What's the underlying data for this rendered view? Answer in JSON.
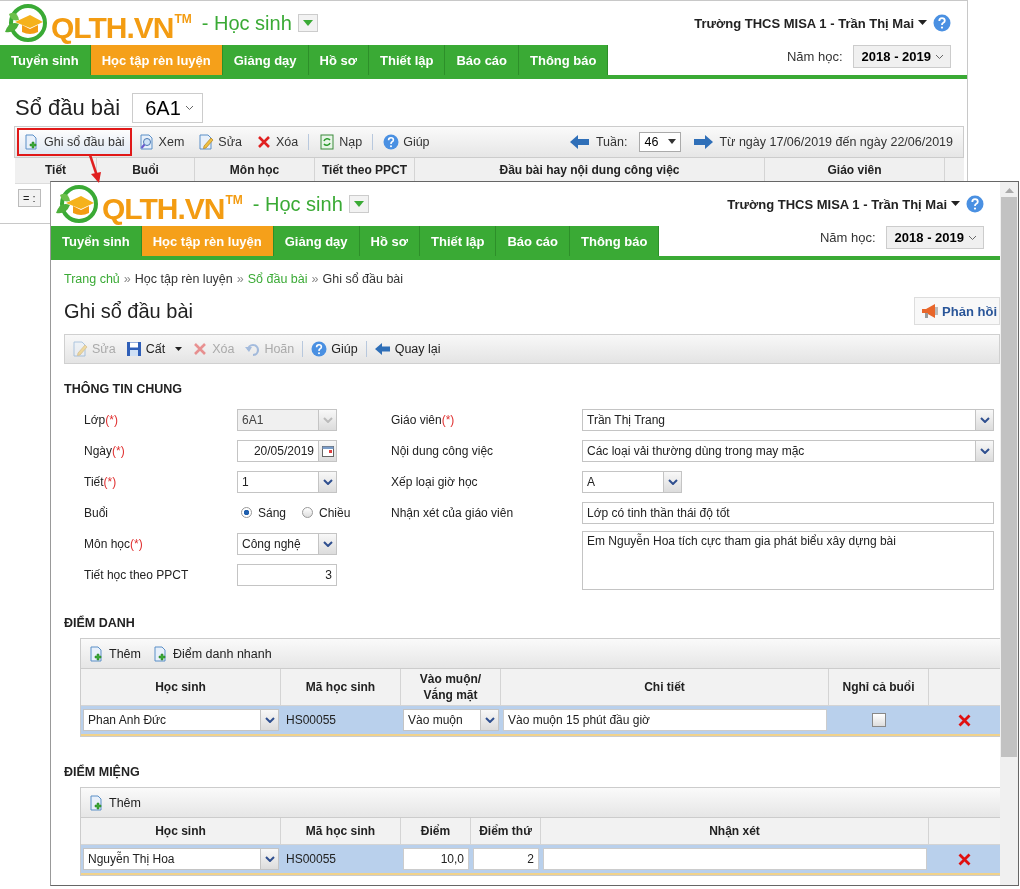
{
  "back_window": {
    "header": {
      "brand": "QLTH.VN",
      "trademark": "TM",
      "role": "- Học sinh",
      "user": "Trường THCS MISA 1 - Trần Thị Mai"
    },
    "nav": [
      {
        "label": "Tuyển sinh",
        "selected": false
      },
      {
        "label": "Học tập rèn luyện",
        "selected": true
      },
      {
        "label": "Giảng dạy",
        "selected": false
      },
      {
        "label": "Hồ sơ",
        "selected": false
      },
      {
        "label": "Thiết lập",
        "selected": false
      },
      {
        "label": "Báo cáo",
        "selected": false
      },
      {
        "label": "Thông báo",
        "selected": false
      }
    ],
    "school_year": {
      "label": "Năm học:",
      "value": "2018 - 2019"
    },
    "page_title": "Sổ đầu bài",
    "class_select": "6A1",
    "toolbar_groups": [
      {
        "items": [
          {
            "label": "Ghi sổ đầu bài",
            "kind": "add",
            "highlighted": true
          },
          {
            "label": "Xem",
            "kind": "view",
            "highlighted": false
          },
          {
            "label": "Sửa",
            "kind": "edit",
            "highlighted": false
          },
          {
            "label": "Xóa",
            "kind": "delete",
            "highlighted": false
          }
        ]
      },
      {
        "items": [
          {
            "label": "Nạp",
            "kind": "reload",
            "highlighted": false
          }
        ]
      },
      {
        "items": [
          {
            "label": "Giúp",
            "kind": "help",
            "highlighted": false
          }
        ]
      }
    ],
    "week": {
      "label": "Tuần:",
      "value": "46",
      "range": "Từ ngày 17/06/2019 đến ngày 22/06/2019"
    },
    "columns": [
      "Tiết",
      "Buổi",
      "Môn học",
      "Tiết theo PPCT",
      "Đầu bài hay nội dung công việc",
      "Giáo viên"
    ],
    "filter_operator": "= :"
  },
  "front_window": {
    "header": {
      "brand": "QLTH.VN",
      "trademark": "TM",
      "role": "- Học sinh",
      "user": "Trường THCS MISA 1 - Trần Thị Mai"
    },
    "nav": [
      {
        "label": "Tuyển sinh",
        "selected": false
      },
      {
        "label": "Học tập rèn luyện",
        "selected": true
      },
      {
        "label": "Giảng dạy",
        "selected": false
      },
      {
        "label": "Hồ sơ",
        "selected": false
      },
      {
        "label": "Thiết lập",
        "selected": false
      },
      {
        "label": "Báo cáo",
        "selected": false
      },
      {
        "label": "Thông báo",
        "selected": false
      }
    ],
    "school_year": {
      "label": "Năm học:",
      "value": "2018 - 2019"
    },
    "breadcrumbs": [
      {
        "label": "Trang chủ",
        "link": true
      },
      {
        "prefix": "»",
        "label": "Học tập rèn luyện",
        "link": false
      },
      {
        "prefix": "»",
        "label": "Sổ đầu bài",
        "link": true
      },
      {
        "prefix": "»",
        "label": "Ghi sổ đầu bài",
        "link": false
      }
    ],
    "page_title": "Ghi sổ đầu bài",
    "feedback_button": "Phản hồi",
    "toolbar_groups": [
      {
        "items": [
          {
            "label": "Sửa",
            "kind": "edit",
            "disabled": true,
            "menu": false
          },
          {
            "label": "Cất",
            "kind": "save",
            "disabled": false,
            "menu": true
          },
          {
            "label": "Xóa",
            "kind": "delete",
            "disabled": true,
            "menu": false
          },
          {
            "label": "Hoãn",
            "kind": "undo",
            "disabled": true,
            "menu": false
          }
        ]
      },
      {
        "items": [
          {
            "label": "Giúp",
            "kind": "help",
            "disabled": false,
            "menu": false
          }
        ]
      },
      {
        "items": [
          {
            "label": "Quay lại",
            "kind": "back",
            "disabled": false,
            "menu": false
          }
        ]
      }
    ],
    "general": {
      "title": "THÔNG TIN CHUNG",
      "left_fields": [
        {
          "label": "Lớp",
          "mark": "(*)",
          "kind": "combo",
          "disabled": true,
          "value": "6A1"
        },
        {
          "label": "Ngày",
          "mark": "(*)",
          "kind": "date",
          "disabled": false,
          "value": "20/05/2019"
        },
        {
          "label": "Tiết",
          "mark": "(*)",
          "kind": "combo",
          "disabled": false,
          "value": "1"
        },
        {
          "label": "Buổi",
          "kind": "radio",
          "options": [
            {
              "label": "Sáng",
              "selected": true
            },
            {
              "label": "Chiều",
              "selected": false
            }
          ]
        },
        {
          "label": "Môn học",
          "mark": "(*)",
          "kind": "combo",
          "disabled": false,
          "value": "Công nghệ"
        },
        {
          "label": "Tiết học theo PPCT",
          "kind": "number",
          "disabled": false,
          "value": "3"
        }
      ],
      "right_fields": [
        {
          "label": "Giáo viên",
          "mark": "(*)",
          "kind": "combo",
          "value": "Trần Thị Trang"
        },
        {
          "label": "Nội dung công việc",
          "kind": "combo",
          "value": "Các loại vải thường dùng trong may mặc"
        },
        {
          "label": "Xếp loại giờ học",
          "kind": "short_combo",
          "value": "A"
        },
        {
          "label": "Nhận xét của giáo viên",
          "kind": "text",
          "value": "Lớp có tinh thần thái độ tốt"
        },
        {
          "kind": "textarea",
          "value": "Em Nguyễn Hoa tích cực tham gia phát biểu xây dựng bài"
        }
      ]
    },
    "attendance": {
      "title": "ĐIỂM DANH",
      "actions": [
        "Thêm",
        "Điểm danh nhanh"
      ],
      "columns": [
        "Học sinh",
        "Mã học sinh",
        "Vào muộn/\nVắng mặt",
        "Chi tiết",
        "Nghỉ cả buổi"
      ],
      "rows": [
        {
          "student": "Phan Anh Đức",
          "code": "HS00055",
          "status": "Vào muộn",
          "detail": "Vào muộn 15 phút đầu giờ",
          "full_day": false,
          "selected": true
        }
      ]
    },
    "oral": {
      "title": "ĐIỂM MIỆNG",
      "actions": [
        "Thêm"
      ],
      "columns": [
        "Học sinh",
        "Mã học sinh",
        "Điểm",
        "Điểm thứ",
        "Nhận xét"
      ],
      "rows": [
        {
          "student": "Nguyễn Thị Hoa",
          "code": "HS00055",
          "score": "10,0",
          "order": "2",
          "selected": true
        }
      ]
    }
  }
}
